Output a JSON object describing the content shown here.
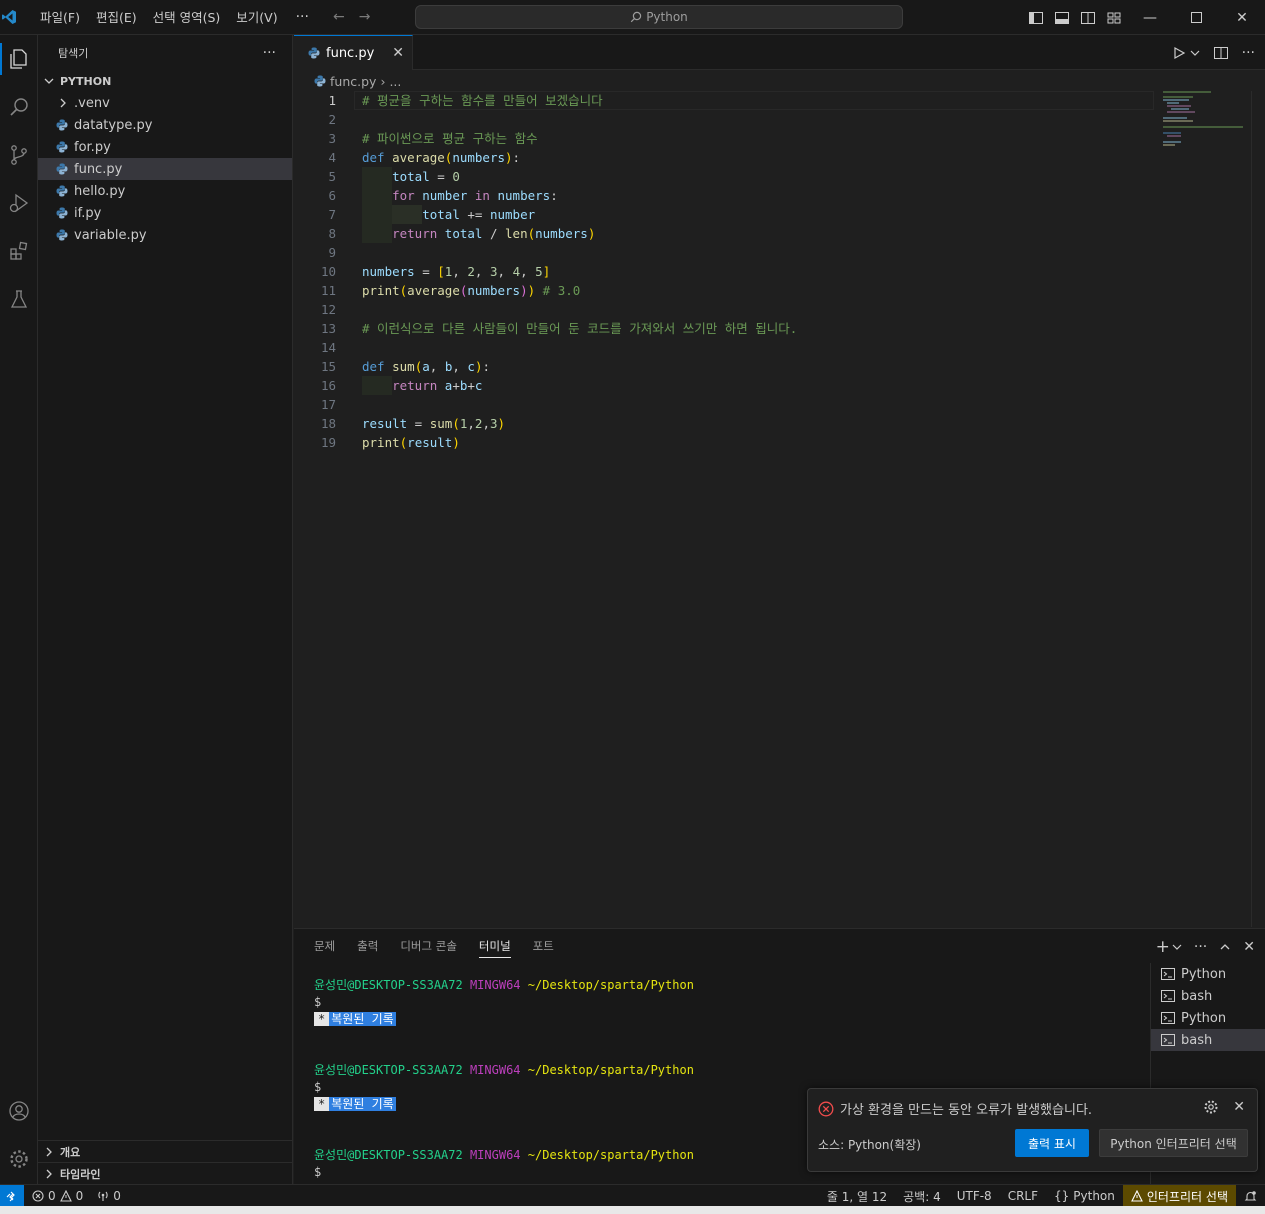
{
  "titlebar": {
    "menus": [
      "파일(F)",
      "편집(E)",
      "선택 영역(S)",
      "보기(V)"
    ],
    "more": "···",
    "search_text": "Python"
  },
  "sidebar": {
    "title": "탐색기",
    "more": "···",
    "section": "PYTHON",
    "items": [
      {
        "label": ".venv",
        "kind": "folder"
      },
      {
        "label": "datatype.py",
        "kind": "python"
      },
      {
        "label": "for.py",
        "kind": "python"
      },
      {
        "label": "func.py",
        "kind": "python",
        "selected": true
      },
      {
        "label": "hello.py",
        "kind": "python"
      },
      {
        "label": "if.py",
        "kind": "python"
      },
      {
        "label": "variable.py",
        "kind": "python"
      }
    ],
    "outline": "개요",
    "timeline": "타임라인"
  },
  "editor": {
    "tab_label": "func.py",
    "breadcrumb_file": "func.py",
    "breadcrumb_more": "...",
    "lines": [
      {
        "n": "1",
        "indent": 0,
        "tokens": [
          [
            "cmt",
            "# 평균을 구하는 함수를 만들어 보겠습니다"
          ]
        ]
      },
      {
        "n": "2",
        "indent": 0,
        "tokens": []
      },
      {
        "n": "3",
        "indent": 0,
        "tokens": [
          [
            "cmt",
            "# 파이썬으로 평균 구하는 함수"
          ]
        ]
      },
      {
        "n": "4",
        "indent": 0,
        "tokens": [
          [
            "kw",
            "def"
          ],
          [
            "",
            " "
          ],
          [
            "fn",
            "average"
          ],
          [
            "br1",
            "("
          ],
          [
            "var",
            "numbers"
          ],
          [
            "br1",
            ")"
          ],
          [
            "",
            ":"
          ]
        ]
      },
      {
        "n": "5",
        "indent": 1,
        "tokens": [
          [
            "var",
            "total"
          ],
          [
            "",
            " = "
          ],
          [
            "num",
            "0"
          ]
        ]
      },
      {
        "n": "6",
        "indent": 1,
        "tokens": [
          [
            "ctl",
            "for"
          ],
          [
            "",
            " "
          ],
          [
            "var",
            "number"
          ],
          [
            "",
            " "
          ],
          [
            "ctl",
            "in"
          ],
          [
            "",
            " "
          ],
          [
            "var",
            "numbers"
          ],
          [
            "",
            ":"
          ]
        ]
      },
      {
        "n": "7",
        "indent": 2,
        "tokens": [
          [
            "var",
            "total"
          ],
          [
            "",
            " += "
          ],
          [
            "var",
            "number"
          ]
        ]
      },
      {
        "n": "8",
        "indent": 1,
        "tokens": [
          [
            "ctl",
            "return"
          ],
          [
            "",
            " "
          ],
          [
            "var",
            "total"
          ],
          [
            "",
            " / "
          ],
          [
            "fn",
            "len"
          ],
          [
            "br1",
            "("
          ],
          [
            "var",
            "numbers"
          ],
          [
            "br1",
            ")"
          ]
        ]
      },
      {
        "n": "9",
        "indent": 0,
        "tokens": []
      },
      {
        "n": "10",
        "indent": 0,
        "tokens": [
          [
            "var",
            "numbers"
          ],
          [
            "",
            " = "
          ],
          [
            "br1",
            "["
          ],
          [
            "num",
            "1"
          ],
          [
            "",
            ", "
          ],
          [
            "num",
            "2"
          ],
          [
            "",
            ", "
          ],
          [
            "num",
            "3"
          ],
          [
            "",
            ", "
          ],
          [
            "num",
            "4"
          ],
          [
            "",
            ", "
          ],
          [
            "num",
            "5"
          ],
          [
            "br1",
            "]"
          ]
        ]
      },
      {
        "n": "11",
        "indent": 0,
        "tokens": [
          [
            "fn",
            "print"
          ],
          [
            "br1",
            "("
          ],
          [
            "fn",
            "average"
          ],
          [
            "br2",
            "("
          ],
          [
            "var",
            "numbers"
          ],
          [
            "br2",
            ")"
          ],
          [
            "br1",
            ")"
          ],
          [
            "",
            " "
          ],
          [
            "cmt",
            "# 3.0"
          ]
        ]
      },
      {
        "n": "12",
        "indent": 0,
        "tokens": []
      },
      {
        "n": "13",
        "indent": 0,
        "tokens": [
          [
            "cmt",
            "# 이런식으로 다른 사람들이 만들어 둔 코드를 가져와서 쓰기만 하면 됩니다."
          ]
        ]
      },
      {
        "n": "14",
        "indent": 0,
        "tokens": []
      },
      {
        "n": "15",
        "indent": 0,
        "tokens": [
          [
            "kw",
            "def"
          ],
          [
            "",
            " "
          ],
          [
            "fn",
            "sum"
          ],
          [
            "br1",
            "("
          ],
          [
            "var",
            "a"
          ],
          [
            "",
            ", "
          ],
          [
            "var",
            "b"
          ],
          [
            "",
            ", "
          ],
          [
            "var",
            "c"
          ],
          [
            "br1",
            ")"
          ],
          [
            "",
            ":"
          ]
        ]
      },
      {
        "n": "16",
        "indent": 1,
        "tokens": [
          [
            "ctl",
            "return"
          ],
          [
            "",
            " "
          ],
          [
            "var",
            "a"
          ],
          [
            "",
            "+"
          ],
          [
            "var",
            "b"
          ],
          [
            "",
            "+"
          ],
          [
            "var",
            "c"
          ]
        ]
      },
      {
        "n": "17",
        "indent": 0,
        "tokens": []
      },
      {
        "n": "18",
        "indent": 0,
        "tokens": [
          [
            "var",
            "result"
          ],
          [
            "",
            " = "
          ],
          [
            "fn",
            "sum"
          ],
          [
            "br1",
            "("
          ],
          [
            "num",
            "1"
          ],
          [
            "",
            ","
          ],
          [
            "num",
            "2"
          ],
          [
            "",
            ","
          ],
          [
            "num",
            "3"
          ],
          [
            "br1",
            ")"
          ]
        ]
      },
      {
        "n": "19",
        "indent": 0,
        "tokens": [
          [
            "fn",
            "print"
          ],
          [
            "br1",
            "("
          ],
          [
            "var",
            "result"
          ],
          [
            "br1",
            ")"
          ]
        ]
      }
    ]
  },
  "panel": {
    "tabs": [
      "문제",
      "출력",
      "디버그 콘솔",
      "터미널",
      "포트"
    ],
    "active_tab": "터미널",
    "terminal_blocks": [
      {
        "user": "윤성민@DESKTOP-SS3AA72",
        "system": "MINGW64",
        "path": "~/Desktop/sparta/Python",
        "prompt": "$",
        "restored": "복원된 기록",
        "star": "*"
      },
      {
        "user": "윤성민@DESKTOP-SS3AA72",
        "system": "MINGW64",
        "path": "~/Desktop/sparta/Python",
        "prompt": "$",
        "restored": "복원된 기록",
        "star": "*"
      },
      {
        "user": "윤성민@DESKTOP-SS3AA72",
        "system": "MINGW64",
        "path": "~/Desktop/sparta/Python",
        "prompt": "$",
        "restored": "",
        "star": ""
      }
    ],
    "terminals": [
      "Python",
      "bash",
      "Python",
      "bash"
    ],
    "selected_terminal": 3
  },
  "notification": {
    "message": "가상 환경을 만드는 동안 오류가 발생했습니다.",
    "source": "소스: Python(확장)",
    "primary": "출력 표시",
    "secondary": "Python 인터프리터 선택"
  },
  "statusbar": {
    "errors": "0",
    "warnings": "0",
    "ports": "0",
    "position": "줄 1, 열 12",
    "spaces": "공백: 4",
    "encoding": "UTF-8",
    "eol": "CRLF",
    "language": "Python",
    "interpreter": "인터프리터 선택"
  },
  "colors": {
    "accent": "#0078d4",
    "warning_bg": "#5c4a00",
    "comment": "#6a9955",
    "keyword": "#569cd6"
  }
}
